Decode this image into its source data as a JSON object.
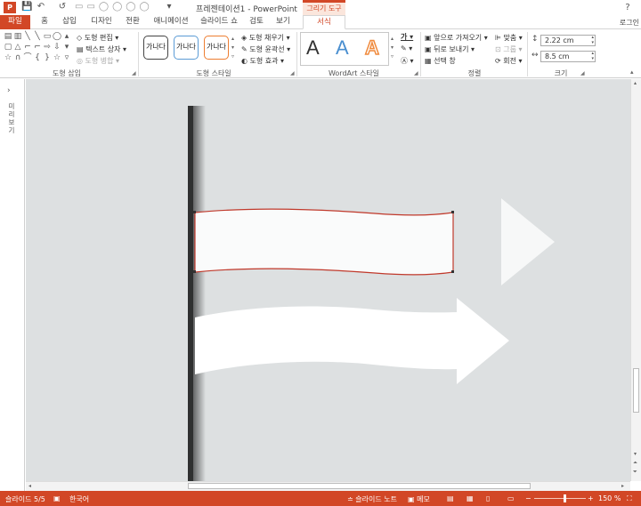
{
  "titlebar": {
    "app_badge": "P",
    "title": "프레젠테이션1 - PowerPoint",
    "context_tab": "그리기 도구",
    "help": "?"
  },
  "quick_access": {
    "save": "💾",
    "undo": "↶",
    "redo": "↺",
    "more": "▾"
  },
  "tabs": [
    {
      "label": "파일"
    },
    {
      "label": "홈"
    },
    {
      "label": "삽입"
    },
    {
      "label": "디자인"
    },
    {
      "label": "전환"
    },
    {
      "label": "애니메이션"
    },
    {
      "label": "슬라이드 쇼"
    },
    {
      "label": "검토"
    },
    {
      "label": "보기"
    },
    {
      "label": "서식"
    }
  ],
  "login": "로그인",
  "ribbon": {
    "insert_shapes": {
      "label": "도형 삽입",
      "edit_shape": "도형 편집 ▾",
      "text_box": "텍스트 상자 ▾",
      "merge_shapes": "도형 병합 ▾"
    },
    "shape_styles": {
      "label": "도형 스타일",
      "presets": [
        "가나다",
        "가나다",
        "가나다"
      ],
      "fill": "도형 채우기 ▾",
      "outline": "도형 윤곽선 ▾",
      "effects": "도형 효과 ▾"
    },
    "wordart": {
      "label": "WordArt 스타일",
      "letters": [
        "A",
        "A",
        "A"
      ],
      "colors": [
        "#111111",
        "#4a8fd0",
        "#f08a3c"
      ]
    },
    "arrange": {
      "label": "정렬",
      "bring_forward": "앞으로 가져오기 ▾",
      "send_backward": "뒤로 보내기 ▾",
      "selection_pane": "선택 창",
      "align": "맞춤 ▾",
      "group": "그룹 ▾",
      "rotate": "회전 ▾"
    },
    "size": {
      "label": "크기",
      "height": "2.22 cm",
      "width": "8.5 cm"
    }
  },
  "left_panel": {
    "toggle": "›",
    "label": "미리보기"
  },
  "status": {
    "slide": "슬라이드 5/5",
    "language": "한국어",
    "notes": "≐ 슬라이드 노트",
    "comments": "▣ 메모",
    "zoom": "150 %",
    "zoom_level_percent": 150
  },
  "colors": {
    "accent": "#d24726",
    "canvas": "#dde0e1",
    "shape_outline": "#c0392b"
  }
}
